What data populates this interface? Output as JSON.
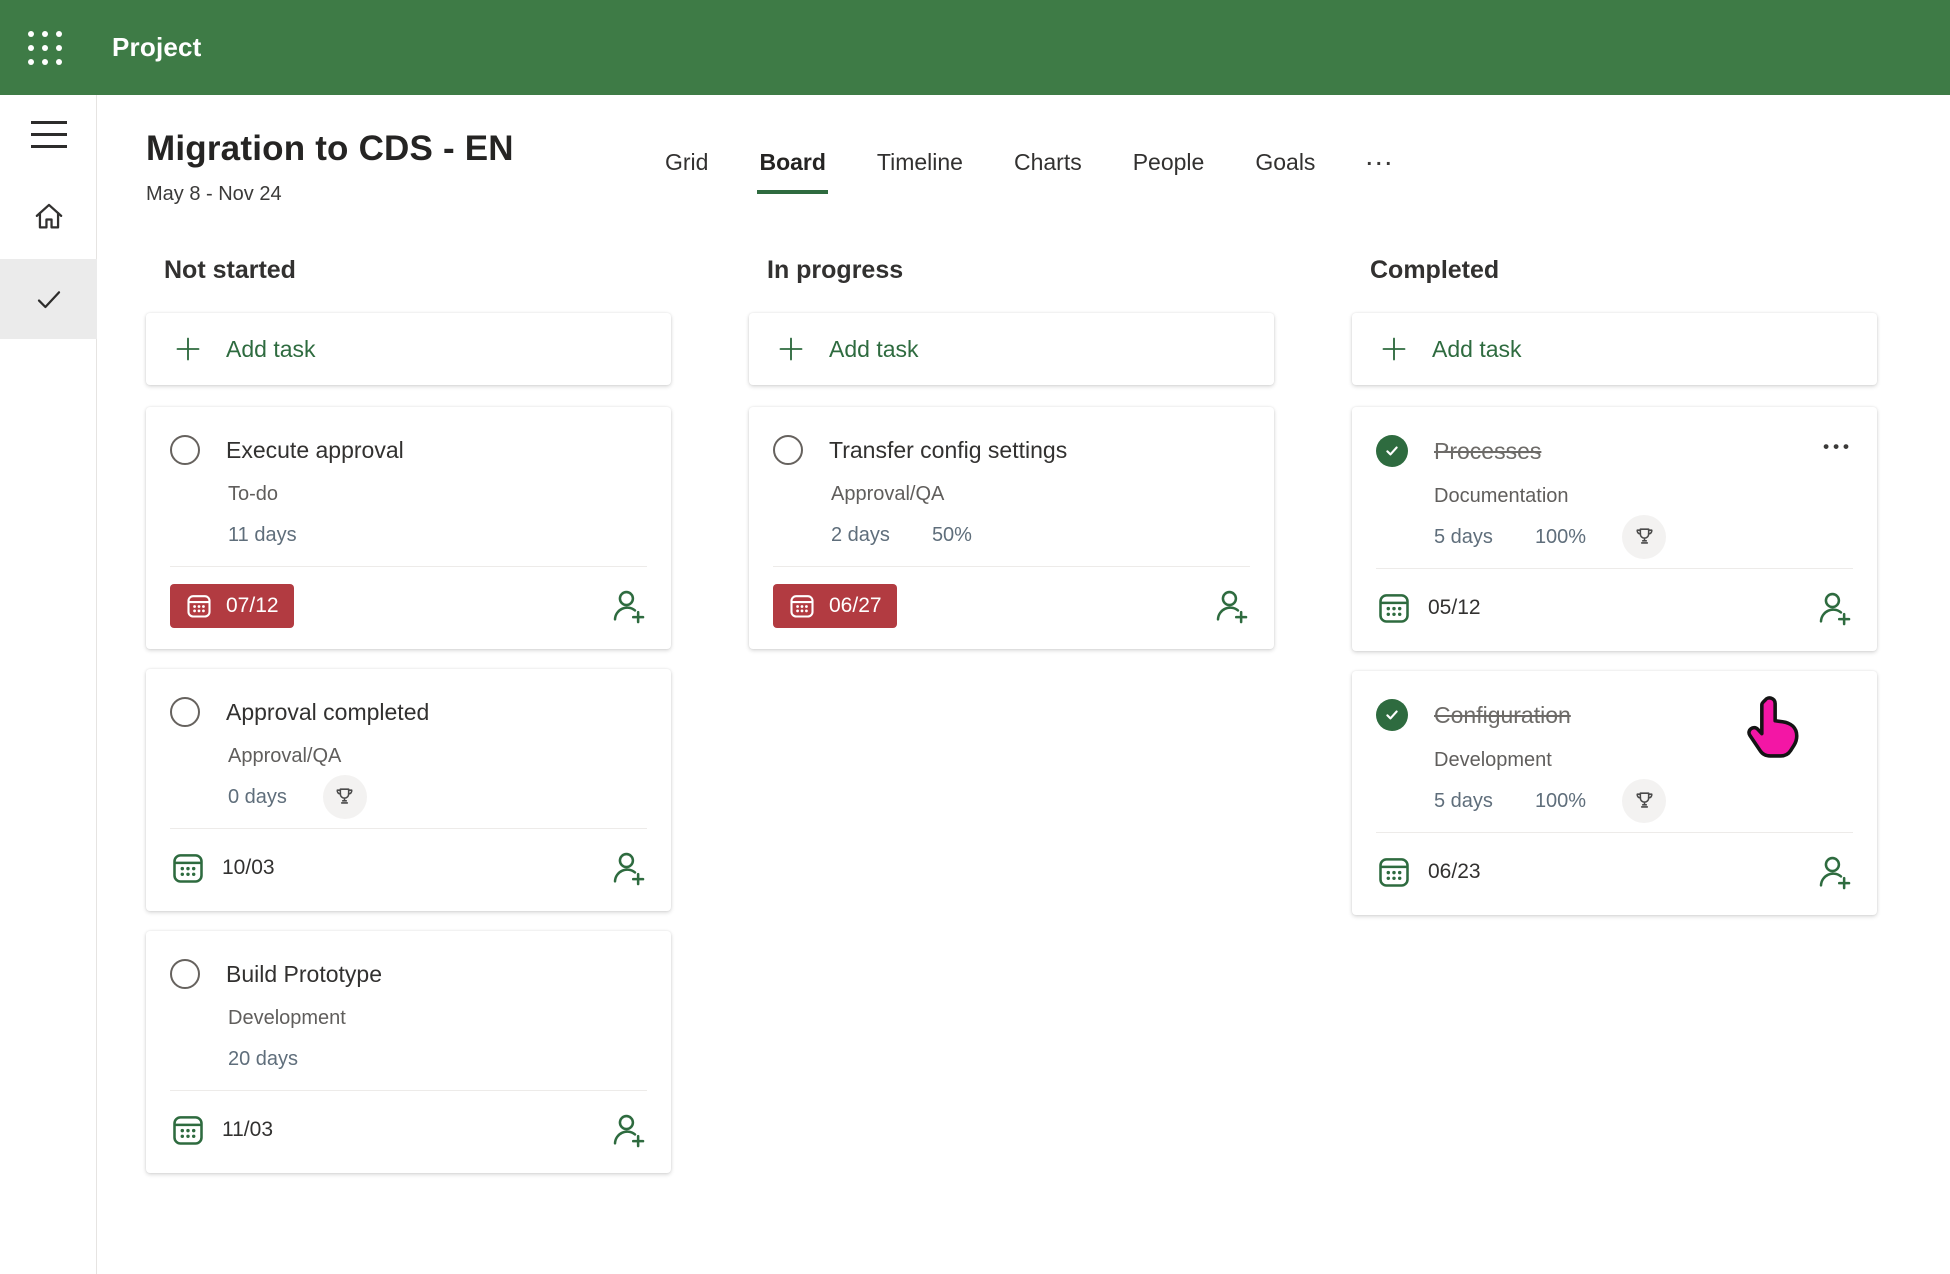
{
  "app": {
    "name": "Project"
  },
  "header": {
    "title": "Migration to CDS - EN",
    "date_range": "May 8 - Nov 24",
    "tabs": [
      {
        "label": "Grid",
        "active": false
      },
      {
        "label": "Board",
        "active": true
      },
      {
        "label": "Timeline",
        "active": false
      },
      {
        "label": "Charts",
        "active": false
      },
      {
        "label": "People",
        "active": false
      },
      {
        "label": "Goals",
        "active": false
      },
      {
        "label": "...",
        "active": false,
        "overflow": true
      }
    ]
  },
  "colors": {
    "topbar_green": "#3e7b46",
    "accent_green": "#2e6b3f",
    "late_red": "#b23b41",
    "milestone_circle_bg": "#f3f2f1",
    "selected_nav_bg": "#ebebeb",
    "cursor_pink": "#f316a5"
  },
  "board": {
    "columns": [
      {
        "name": "Not started",
        "add_task_label": "Add task",
        "cards": [
          {
            "title": "Execute approval",
            "completed": false,
            "bucket": "To-do",
            "duration": "11 days",
            "progress": "",
            "milestone": false,
            "date": "07/12",
            "date_late": true,
            "menu": false
          },
          {
            "title": "Approval completed",
            "completed": false,
            "bucket": "Approval/QA",
            "duration": "0 days",
            "progress": "",
            "milestone": true,
            "date": "10/03",
            "date_late": false,
            "menu": false
          },
          {
            "title": "Build Prototype",
            "completed": false,
            "bucket": "Development",
            "duration": "20 days",
            "progress": "",
            "milestone": false,
            "date": "11/03",
            "date_late": false,
            "menu": false
          }
        ]
      },
      {
        "name": "In progress",
        "add_task_label": "Add task",
        "cards": [
          {
            "title": "Transfer config settings",
            "completed": false,
            "bucket": "Approval/QA",
            "duration": "2 days",
            "progress": "50%",
            "milestone": false,
            "date": "06/27",
            "date_late": true,
            "menu": false
          }
        ]
      },
      {
        "name": "Completed",
        "add_task_label": "Add task",
        "cards": [
          {
            "title": "Processes",
            "completed": true,
            "bucket": "Documentation",
            "duration": "5 days",
            "progress": "100%",
            "milestone": true,
            "date": "05/12",
            "date_late": false,
            "menu": true
          },
          {
            "title": "Configuration",
            "completed": true,
            "bucket": "Development",
            "duration": "5 days",
            "progress": "100%",
            "milestone": true,
            "date": "06/23",
            "date_late": false,
            "menu": false
          }
        ]
      }
    ]
  }
}
